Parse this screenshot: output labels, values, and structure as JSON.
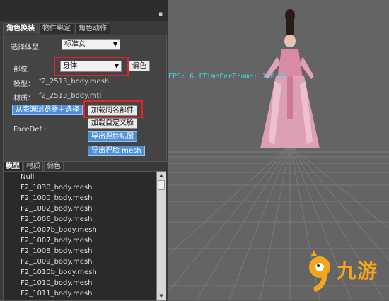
{
  "panel": {
    "pin_glyph": "▪",
    "tabs": [
      "角色换装",
      "物件绑定",
      "角色动作"
    ],
    "body_type_label": "选择体型",
    "body_type_value": "标准女",
    "part_label": "部位",
    "part_value": "身体",
    "makeup_button": "偏色",
    "model_label": "模型：",
    "model_value": "f2_2513_body.mesh",
    "material_label": "材质：",
    "material_value": "f2_2513_body.mtl",
    "browser_select_button": "从资源浏览器中选择",
    "load_same_name_button": "加载同名部件",
    "load_custom_face_button": "加载自定义脸",
    "faceDef_label": "FaceDef :",
    "export_face_map_button": "导出捏脸贴图",
    "export_face_mesh_button": "导出捏脸 mesh",
    "sub_tabs": [
      "模型",
      "材质",
      "偏色"
    ],
    "mesh_list": [
      "Null",
      "F2_1030_body.mesh",
      "F2_1000_body.mesh",
      "F2_1002_body.mesh",
      "F2_1006_body.mesh",
      "F2_1007b_body.mesh",
      "F2_1007_body.mesh",
      "F2_1008_body.mesh",
      "F2_1009_body.mesh",
      "F2_1010b_body.mesh",
      "F2_1010_body.mesh",
      "F2_1011_body.mesh"
    ]
  },
  "viewport": {
    "fps_text": "FPS: 6 fTimePerFrame: 166.67"
  },
  "watermark": {
    "text": "九游"
  },
  "colors": {
    "highlight": "#e0242b",
    "accent_blue": "#4c8fd8",
    "fps_text": "#3dd6e8",
    "watermark": "#f3a51b"
  }
}
